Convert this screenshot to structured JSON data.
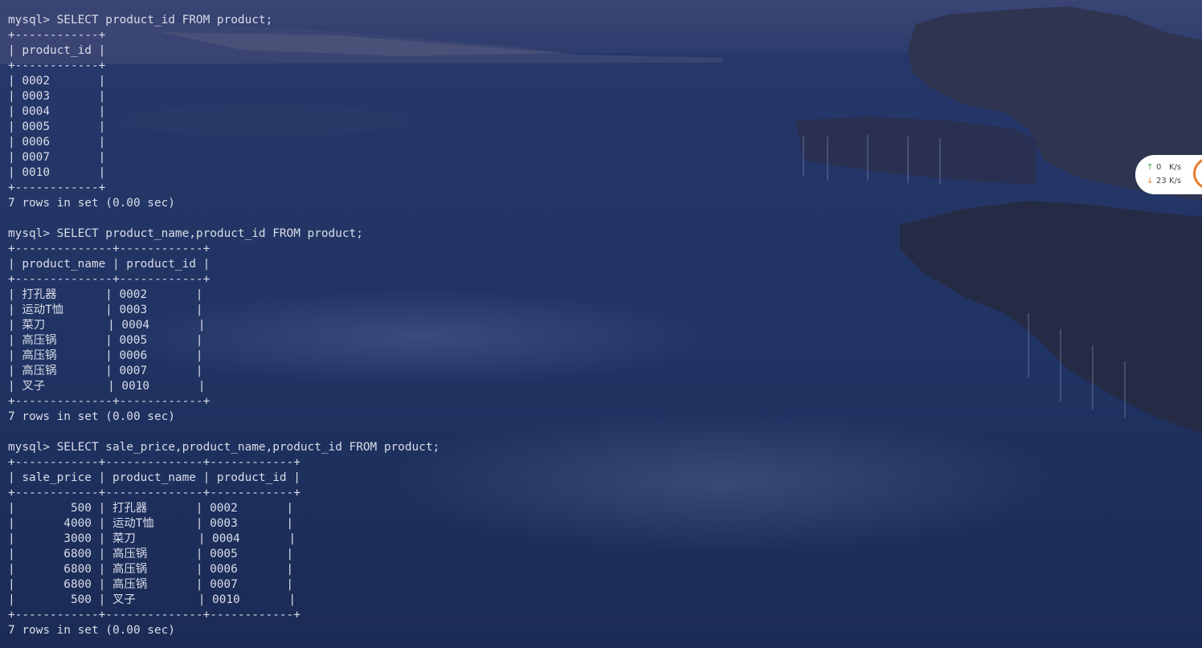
{
  "terminal": {
    "lines": [
      "mysql> SELECT product_id FROM product;",
      "+------------+",
      "| product_id |",
      "+------------+",
      "| 0002       |",
      "| 0003       |",
      "| 0004       |",
      "| 0005       |",
      "| 0006       |",
      "| 0007       |",
      "| 0010       |",
      "+------------+",
      "7 rows in set (0.00 sec)",
      "",
      "mysql> SELECT product_name,product_id FROM product;",
      "+--------------+------------+",
      "| product_name | product_id |",
      "+--------------+------------+",
      "| 打孔器       | 0002       |",
      "| 运动T恤      | 0003       |",
      "| 菜刀         | 0004       |",
      "| 高压锅       | 0005       |",
      "| 高压锅       | 0006       |",
      "| 高压锅       | 0007       |",
      "| 叉子         | 0010       |",
      "+--------------+------------+",
      "7 rows in set (0.00 sec)",
      "",
      "mysql> SELECT sale_price,product_name,product_id FROM product;",
      "+------------+--------------+------------+",
      "| sale_price | product_name | product_id |",
      "+------------+--------------+------------+",
      "|        500 | 打孔器       | 0002       |",
      "|       4000 | 运动T恤      | 0003       |",
      "|       3000 | 菜刀         | 0004       |",
      "|       6800 | 高压锅       | 0005       |",
      "|       6800 | 高压锅       | 0006       |",
      "|       6800 | 高压锅       | 0007       |",
      "|        500 | 叉子         | 0010       |",
      "+------------+--------------+------------+",
      "7 rows in set (0.00 sec)"
    ]
  },
  "network_widget": {
    "upload_value": "0",
    "upload_unit": "K/s",
    "download_value": "23",
    "download_unit": "K/s",
    "upload_icon": "arrow-up-icon",
    "download_icon": "arrow-down-icon",
    "upload_color": "#3aa845",
    "download_color": "#e2802e"
  }
}
